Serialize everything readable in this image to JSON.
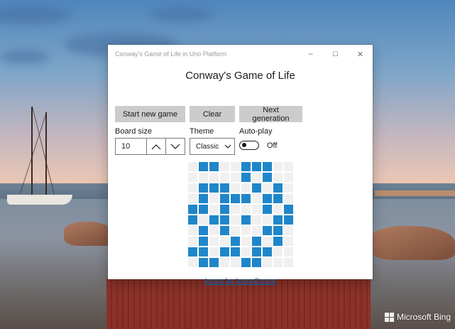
{
  "window": {
    "title": "Conway's Game of Life in Uno Platform",
    "minimize": "–",
    "maximize": "☐",
    "close": "✕"
  },
  "app": {
    "title": "Conway's Game of Life",
    "buttons": {
      "start": "Start new game",
      "clear": "Clear",
      "next": "Next generation"
    },
    "board_size": {
      "label": "Board size",
      "value": "10"
    },
    "theme": {
      "label": "Theme",
      "value": "Classic"
    },
    "autoplay": {
      "label": "Auto-play",
      "state": "Off"
    },
    "board": {
      "alive_color": "#1f86c9",
      "dead_color": "#f0f0f0",
      "cells": [
        "0110011100",
        "0000010100",
        "0111001010",
        "0101110110",
        "1101000101",
        "1011010011",
        "0101000110",
        "0100101010",
        "1101101100",
        "0110011000"
      ]
    },
    "credit": "Icons by Icons8.com"
  },
  "desktop": {
    "watermark": "Microsoft Bing"
  }
}
